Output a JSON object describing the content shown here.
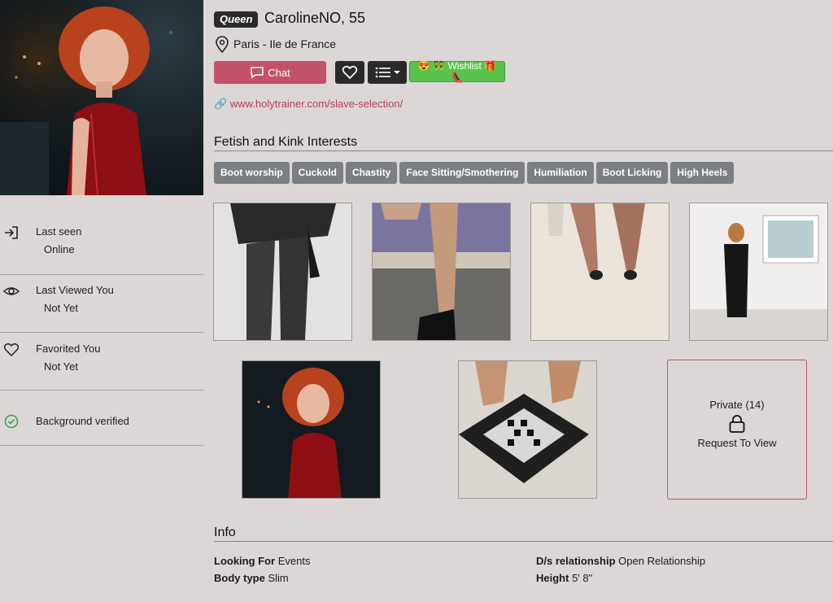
{
  "profile": {
    "badge": "Queen",
    "name": "CarolineNO, 55",
    "location": "Paris - Ile de France",
    "link": "www.holytrainer.com/slave-selection/"
  },
  "actions": {
    "chat_label": "Chat",
    "wishlist_label": "😍 👯 Wishlist 🎁 👠"
  },
  "sidebar": {
    "stats": [
      {
        "label": "Last seen",
        "value": "Online"
      },
      {
        "label": "Last Viewed You",
        "value": "Not Yet"
      },
      {
        "label": "Favorited You",
        "value": "Not Yet"
      },
      {
        "label": "Background verified",
        "value": ""
      }
    ]
  },
  "interests": {
    "title": "Fetish and Kink Interests",
    "tags": [
      "Boot worship",
      "Cuckold",
      "Chastity",
      "Face Sitting/Smothering",
      "Humiliation",
      "Boot Licking",
      "High Heels"
    ]
  },
  "gallery": {
    "private_label": "Private (14)",
    "request_label": "Request To View"
  },
  "info": {
    "title": "Info",
    "looking_for_label": "Looking For",
    "looking_for_value": "Events",
    "body_type_label": "Body type",
    "body_type_value": "Slim",
    "ds_label": "D/s relationship",
    "ds_value": "Open Relationship",
    "height_label": "Height",
    "height_value": "5' 8\""
  },
  "colors": {
    "background": "#dcd6d6",
    "accent": "#c3516a",
    "wishlist": "#59c44b",
    "tag": "#7b7f83"
  }
}
